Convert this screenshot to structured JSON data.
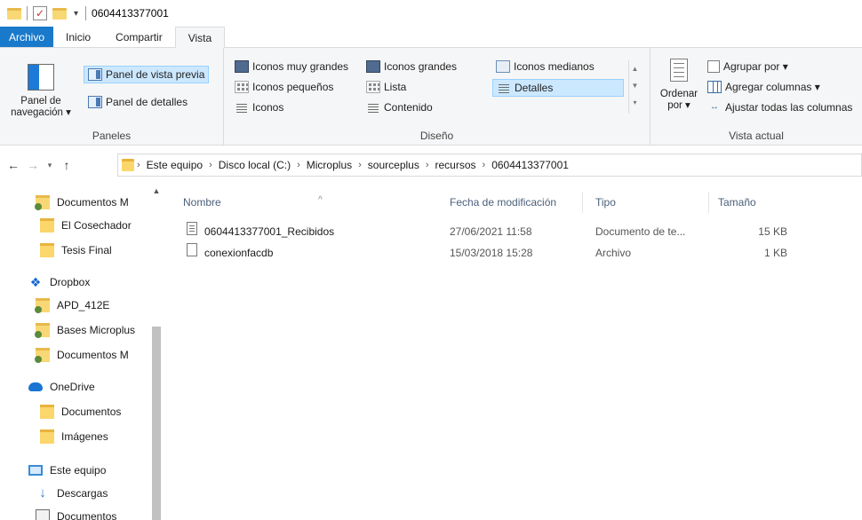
{
  "window": {
    "title": "0604413377001"
  },
  "ribbon_tabs": [
    "Archivo",
    "Inicio",
    "Compartir",
    "Vista"
  ],
  "ribbon": {
    "paneles": {
      "label": "Paneles",
      "nav_pane_line1": "Panel de",
      "nav_pane_line2": "navegación ▾",
      "preview_pane": "Panel de vista previa",
      "details_pane": "Panel de detalles"
    },
    "diseno": {
      "label": "Diseño",
      "extra_large": "Iconos muy grandes",
      "large": "Iconos grandes",
      "medium": "Iconos medianos",
      "small": "Iconos pequeños",
      "list": "Lista",
      "details": "Detalles",
      "icons": "Iconos",
      "content": "Contenido"
    },
    "vista_actual": {
      "label": "Vista actual",
      "sort_line1": "Ordenar",
      "sort_line2": "por ▾",
      "group_by": "Agrupar por ▾",
      "add_columns": "Agregar columnas ▾",
      "fit_columns": "Ajustar todas las columnas"
    }
  },
  "address_bar": {
    "crumbs": [
      "Este equipo",
      "Disco local (C:)",
      "Microplus",
      "sourceplus",
      "recursos",
      "0604413377001"
    ]
  },
  "nav_pane": {
    "items": [
      {
        "label": "Documentos M",
        "icon": "shared-folder-icon"
      },
      {
        "label": "El Cosechador",
        "icon": "folder-icon"
      },
      {
        "label": "Tesis Final",
        "icon": "folder-icon"
      },
      {
        "label": "Dropbox",
        "icon": "dropbox-icon"
      },
      {
        "label": "APD_412E",
        "icon": "shared-folder-icon"
      },
      {
        "label": "Bases Microplus",
        "icon": "shared-folder-icon"
      },
      {
        "label": "Documentos M",
        "icon": "shared-folder-icon"
      },
      {
        "label": "OneDrive",
        "icon": "onedrive-icon"
      },
      {
        "label": "Documentos",
        "icon": "folder-icon"
      },
      {
        "label": "Imágenes",
        "icon": "folder-icon"
      },
      {
        "label": "Este equipo",
        "icon": "computer-icon"
      },
      {
        "label": "Descargas",
        "icon": "download-icon"
      },
      {
        "label": "Documentos",
        "icon": "documents-icon"
      }
    ]
  },
  "file_list": {
    "columns": [
      "Nombre",
      "Fecha de modificación",
      "Tipo",
      "Tamaño"
    ],
    "rows": [
      {
        "name": "0604413377001_Recibidos",
        "date": "27/06/2021 11:58",
        "type": "Documento de te...",
        "size": "15 KB"
      },
      {
        "name": "conexionfacdb",
        "date": "15/03/2018 15:28",
        "type": "Archivo",
        "size": "1 KB"
      }
    ]
  },
  "colors": {
    "file_tab": "#1979ca",
    "selection": "#cce8ff",
    "ribbon_bg": "#f5f6f7"
  }
}
